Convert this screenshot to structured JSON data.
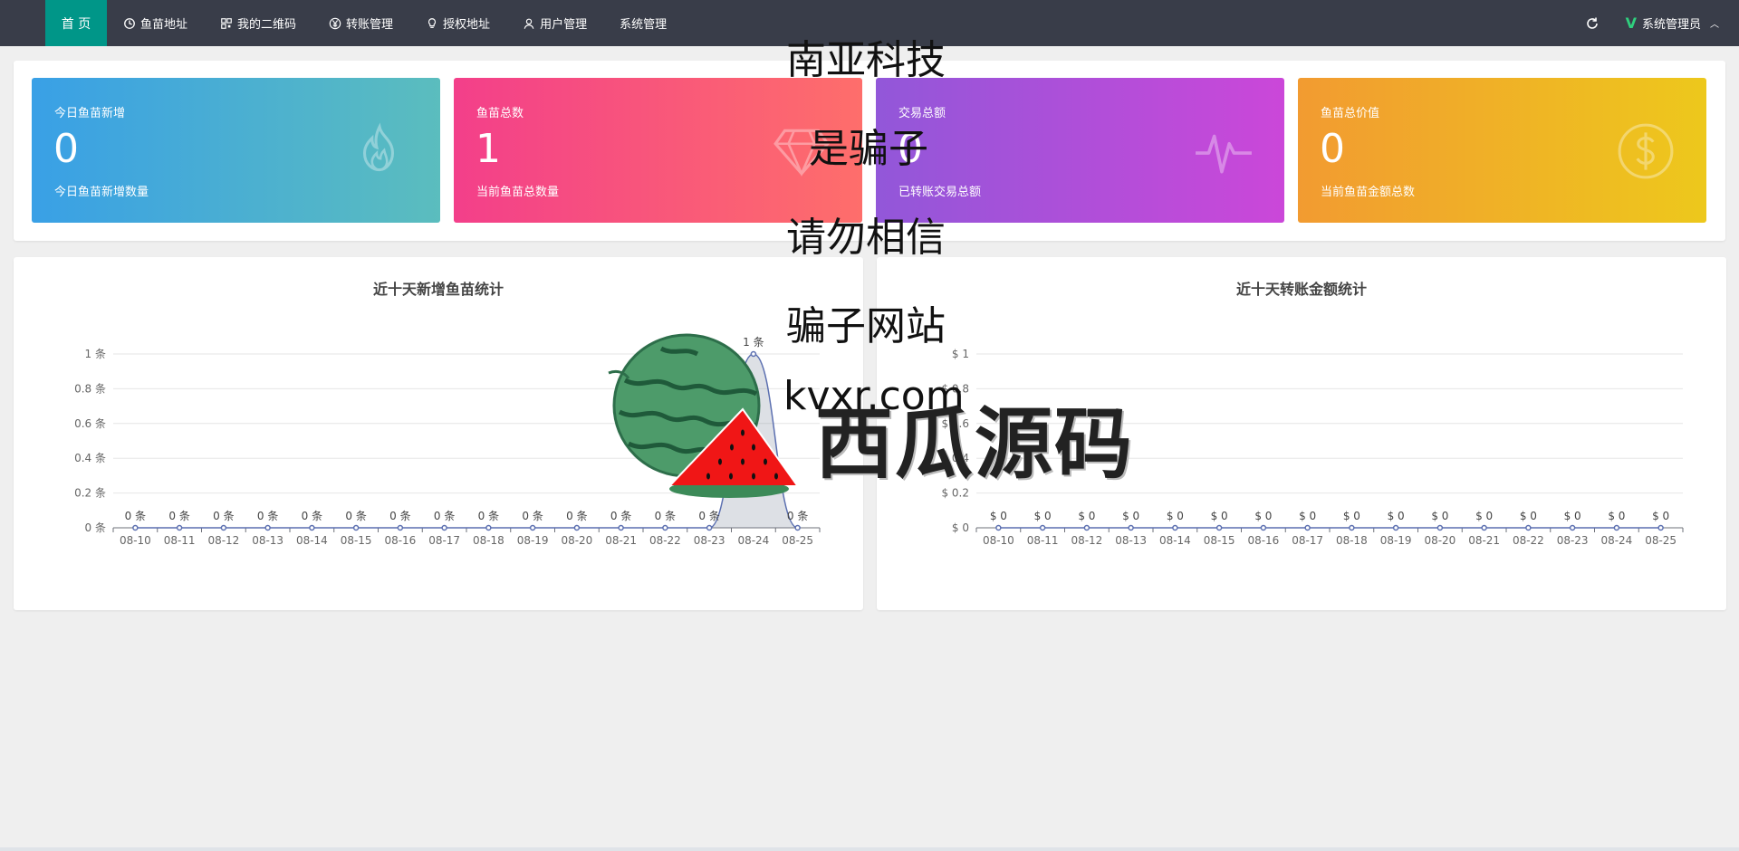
{
  "nav": {
    "home": "首 页",
    "items": [
      {
        "label": "鱼苗地址",
        "icon": "clock-icon"
      },
      {
        "label": "我的二维码",
        "icon": "qrcode-icon"
      },
      {
        "label": "转账管理",
        "icon": "yen-icon"
      },
      {
        "label": "授权地址",
        "icon": "bulb-icon"
      },
      {
        "label": "用户管理",
        "icon": "user-icon"
      },
      {
        "label": "系统管理",
        "icon": ""
      }
    ],
    "user": "系统管理员"
  },
  "stats": [
    {
      "label": "今日鱼苗新增",
      "value": "0",
      "sub": "今日鱼苗新增数量",
      "icon": "fire-icon"
    },
    {
      "label": "鱼苗总数",
      "value": "1",
      "sub": "当前鱼苗总数量",
      "icon": "diamond-icon"
    },
    {
      "label": "交易总额",
      "value": "0",
      "sub": "已转账交易总额",
      "icon": "pulse-icon"
    },
    {
      "label": "鱼苗总价值",
      "value": "0",
      "sub": "当前鱼苗金额总数",
      "icon": "dollar-icon"
    }
  ],
  "chart_data": [
    {
      "type": "line",
      "title": "近十天新增鱼苗统计",
      "categories": [
        "08-10",
        "08-11",
        "08-12",
        "08-13",
        "08-14",
        "08-15",
        "08-16",
        "08-17",
        "08-18",
        "08-19",
        "08-20",
        "08-21",
        "08-22",
        "08-23",
        "08-24",
        "08-25"
      ],
      "values": [
        0,
        0,
        0,
        0,
        0,
        0,
        0,
        0,
        0,
        0,
        0,
        0,
        0,
        0,
        1,
        0
      ],
      "unit_suffix": " 条",
      "unit_prefix": "",
      "yticks": [
        "0 条",
        "0.2 条",
        "0.4 条",
        "0.6 条",
        "0.8 条",
        "1 条"
      ],
      "ylim": [
        0,
        1
      ],
      "line_color": "#5b6fb0",
      "area": true,
      "grid": true
    },
    {
      "type": "line",
      "title": "近十天转账金额统计",
      "categories": [
        "08-10",
        "08-11",
        "08-12",
        "08-13",
        "08-14",
        "08-15",
        "08-16",
        "08-17",
        "08-18",
        "08-19",
        "08-20",
        "08-21",
        "08-22",
        "08-23",
        "08-24",
        "08-25"
      ],
      "values": [
        0,
        0,
        0,
        0,
        0,
        0,
        0,
        0,
        0,
        0,
        0,
        0,
        0,
        0,
        0,
        0
      ],
      "unit_suffix": "",
      "unit_prefix": "$ ",
      "yticks": [
        "$ 0",
        "$ 0.2",
        "$ 0.4",
        "$ 0.6",
        "$ 0.8",
        "$ 1"
      ],
      "ylim": [
        0,
        1
      ],
      "line_color": "#5b6fb0",
      "area": false,
      "grid": true
    }
  ],
  "watermark": {
    "lines": [
      "南亚科技",
      "是骗子",
      "请勿相信",
      "骗子网站",
      "kvxr.com"
    ],
    "brand": "西瓜源码"
  }
}
